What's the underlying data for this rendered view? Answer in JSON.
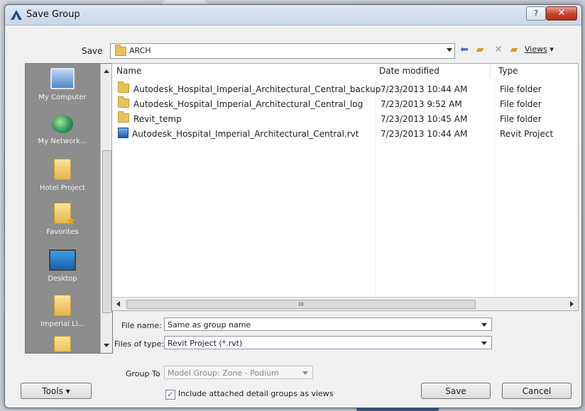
{
  "window": {
    "title": "Save Group",
    "help_glyph": "?",
    "close_glyph": "✕"
  },
  "toolbar": {
    "save_in_label": "Save",
    "path": "ARCH",
    "views_label": "Views"
  },
  "places": [
    {
      "label": "My Computer",
      "icon": "computer-icon"
    },
    {
      "label": "My Network...",
      "icon": "network-icon"
    },
    {
      "label": "Hotel Project",
      "icon": "folder-icon"
    },
    {
      "label": "Favorites",
      "icon": "favorites-icon"
    },
    {
      "label": "Desktop",
      "icon": "desktop-icon"
    },
    {
      "label": "Imperial Li...",
      "icon": "folder-icon"
    }
  ],
  "filelist": {
    "columns": [
      "Name",
      "Date modified",
      "Type"
    ],
    "rows": [
      {
        "name": "Autodesk_Hospital_Imperial_Architectural_Central_backup",
        "date": "7/23/2013 10:44 AM",
        "type": "File folder",
        "icon": "folder-icon"
      },
      {
        "name": "Autodesk_Hospital_Imperial_Architectural_Central_log",
        "date": "7/23/2013 9:52 AM",
        "type": "File folder",
        "icon": "folder-icon"
      },
      {
        "name": "Revit_temp",
        "date": "7/23/2013 10:45 AM",
        "type": "File folder",
        "icon": "folder-icon"
      },
      {
        "name": "Autodesk_Hospital_Imperial_Architectural_Central.rvt",
        "date": "7/23/2013 10:44 AM",
        "type": "Revit Project",
        "icon": "revit-file-icon"
      }
    ],
    "hscroll_grip": "III"
  },
  "form": {
    "file_name_label": "File name:",
    "file_name_value": "Same as group name",
    "file_type_label": "Files of type:",
    "file_type_value": "Revit Project  (*.rvt)",
    "group_to_label": "Group To",
    "group_to_value": "Model Group: Zone - Podium",
    "include_label": "Include attached detail groups as views",
    "include_checked": true
  },
  "buttons": {
    "tools": "Tools",
    "save": "Save",
    "cancel": "Cancel"
  }
}
